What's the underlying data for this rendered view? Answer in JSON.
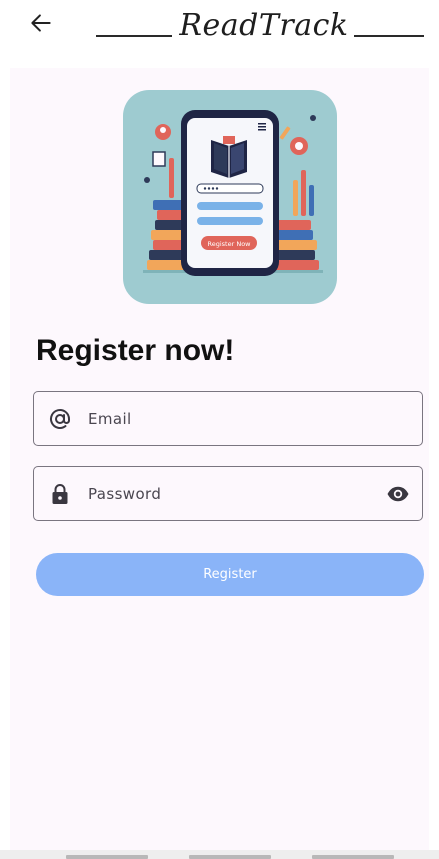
{
  "app_bar": {
    "title": "ReadTrack",
    "back_icon": "arrow-left-icon"
  },
  "hero": {
    "logo_icon": "book-phone-illustration-icon",
    "logo_button_label": "Register Now"
  },
  "form": {
    "heading": "Register now!",
    "email": {
      "icon": "at-sign-icon",
      "placeholder": "Email",
      "value": ""
    },
    "password": {
      "icon": "lock-icon",
      "placeholder": "Password",
      "value": "",
      "toggle_icon": "eye-icon"
    },
    "submit_label": "Register"
  },
  "colors": {
    "accent": "#8ab4f8",
    "surface": "#fdf8fd",
    "logo_bg": "#9ecbd0",
    "outline": "#7a7580"
  }
}
